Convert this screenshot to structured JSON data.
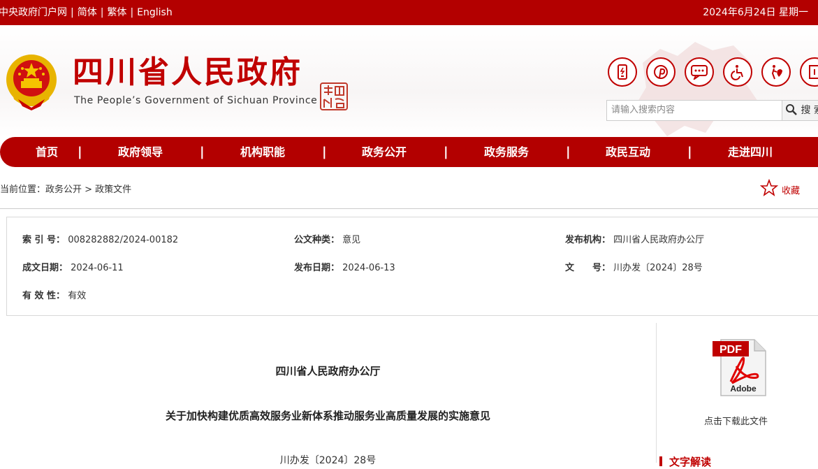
{
  "topbar": {
    "link_central": "中央政府门户网",
    "link_simplified": "简体",
    "link_traditional": "繁体",
    "link_english": "English",
    "separator": "|",
    "date": "2024年6月24日 星期一"
  },
  "header": {
    "title": "四川省人民政府",
    "subtitle": "The People’s Government of Sichuan Province",
    "seal_text": "中国四川",
    "search_placeholder": "请输入搜索内容",
    "search_button": "搜 索",
    "tool_icons": [
      "mobile-icon",
      "pinterest-icon",
      "chat-icon",
      "wheelchair-icon",
      "elderly-care-icon",
      "exit-icon"
    ]
  },
  "nav": {
    "items": [
      "首页",
      "政府领导",
      "机构职能",
      "政务公开",
      "政务服务",
      "政民互动",
      "走进四川"
    ],
    "separator": "|"
  },
  "breadcrumb": {
    "text": "当前位置：政务公开 > 政策文件",
    "favorite_label": "收藏"
  },
  "info": {
    "index_label": "索 引 号：",
    "index_value": "008282882/2024-00182",
    "doc_type_label": "公文种类：",
    "doc_type_value": "意见",
    "publisher_label": "发布机构：",
    "publisher_value": "四川省人民政府办公厅",
    "created_label": "成文日期：",
    "created_value": "2024-06-11",
    "published_label": "发布日期：",
    "published_value": "2024-06-13",
    "docno_label": "文　　号：",
    "docno_value": "川办发〔2024〕28号",
    "validity_label": "有 效 性：",
    "validity_value": "有效"
  },
  "document": {
    "issuer": "四川省人民政府办公厅",
    "title": "关于加快构建优质高效服务业新体系推动服务业高质量发展的实施意见",
    "number": "川办发〔2024〕28号"
  },
  "sidebar": {
    "pdf_label_top": "PDF",
    "pdf_label_bottom": "Adobe",
    "download_caption": "点击下载此文件",
    "heading": "文字解读"
  },
  "colors": {
    "brand_red": "#b30000",
    "title_red": "#c00000"
  }
}
